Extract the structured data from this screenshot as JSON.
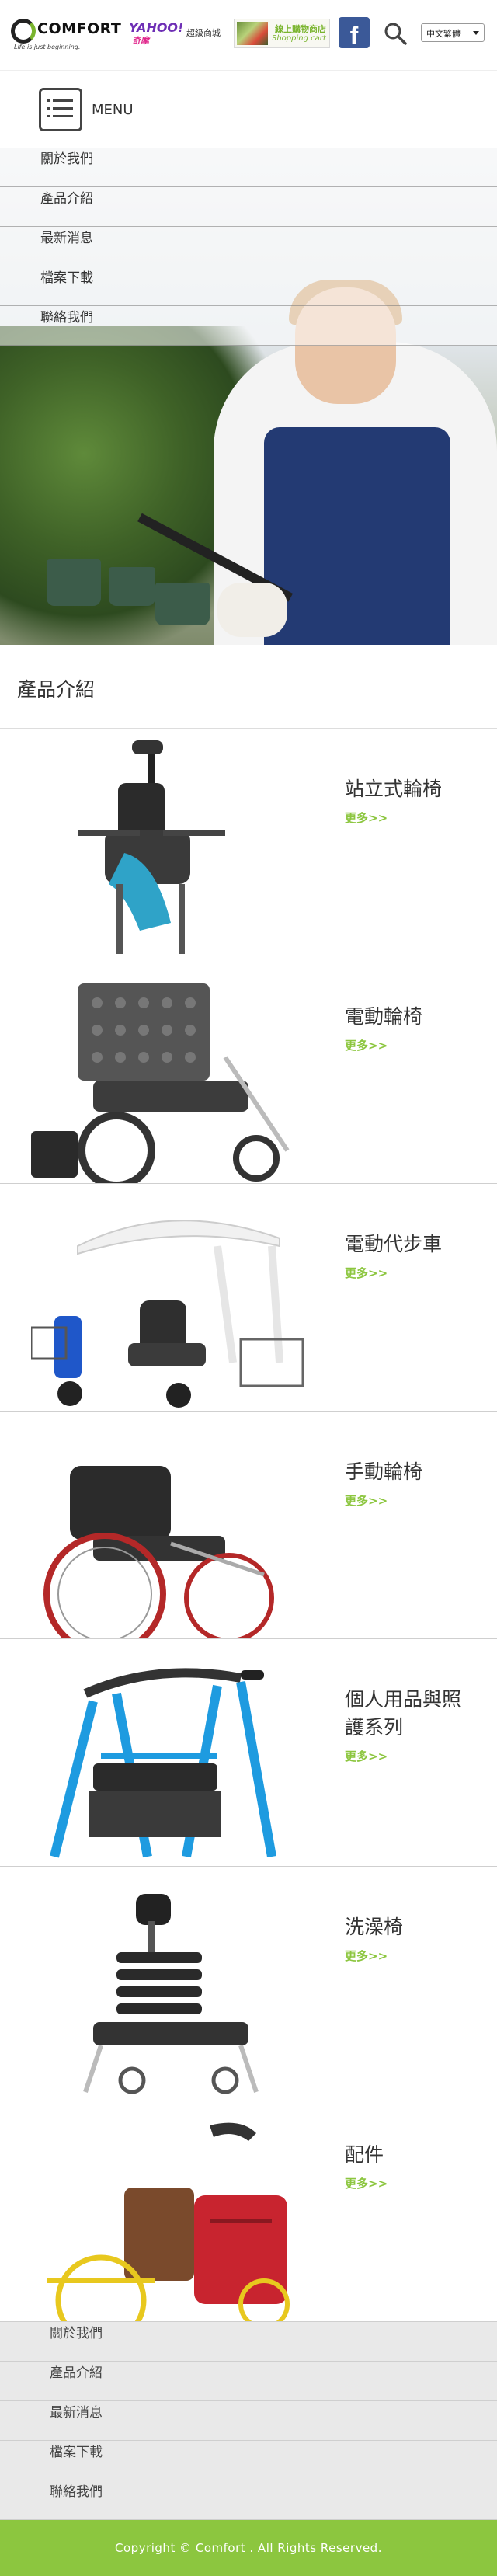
{
  "header": {
    "logo": {
      "word": "COMFORT",
      "tagline": "Life is just beginning."
    },
    "yahoo": {
      "word": "YAHOO!",
      "sub": "奇摩",
      "label": "超級商城"
    },
    "shop": {
      "line1": "線上購物商店",
      "line2": "Shopping cart"
    },
    "language": {
      "selected": "中文繁體"
    }
  },
  "menu": {
    "label": "MENU",
    "items": [
      "關於我們",
      "產品介紹",
      "最新消息",
      "檔案下載",
      "聯絡我們"
    ]
  },
  "products": {
    "title": "產品介紹",
    "more_label": "更多>>",
    "items": [
      {
        "name": "站立式輪椅"
      },
      {
        "name": "電動輪椅"
      },
      {
        "name": "電動代步車"
      },
      {
        "name": "手動輪椅"
      },
      {
        "name": "個人用品與照護系列"
      },
      {
        "name": "洗澡椅"
      },
      {
        "name": "配件"
      }
    ]
  },
  "footer": {
    "items": [
      "關於我們",
      "產品介紹",
      "最新消息",
      "檔案下載",
      "聯絡我們"
    ],
    "copyright": "Copyright © Comfort . All Rights Reserved."
  },
  "colors": {
    "accent": "#8cc63f",
    "facebook": "#3b5998",
    "text": "#333333"
  }
}
